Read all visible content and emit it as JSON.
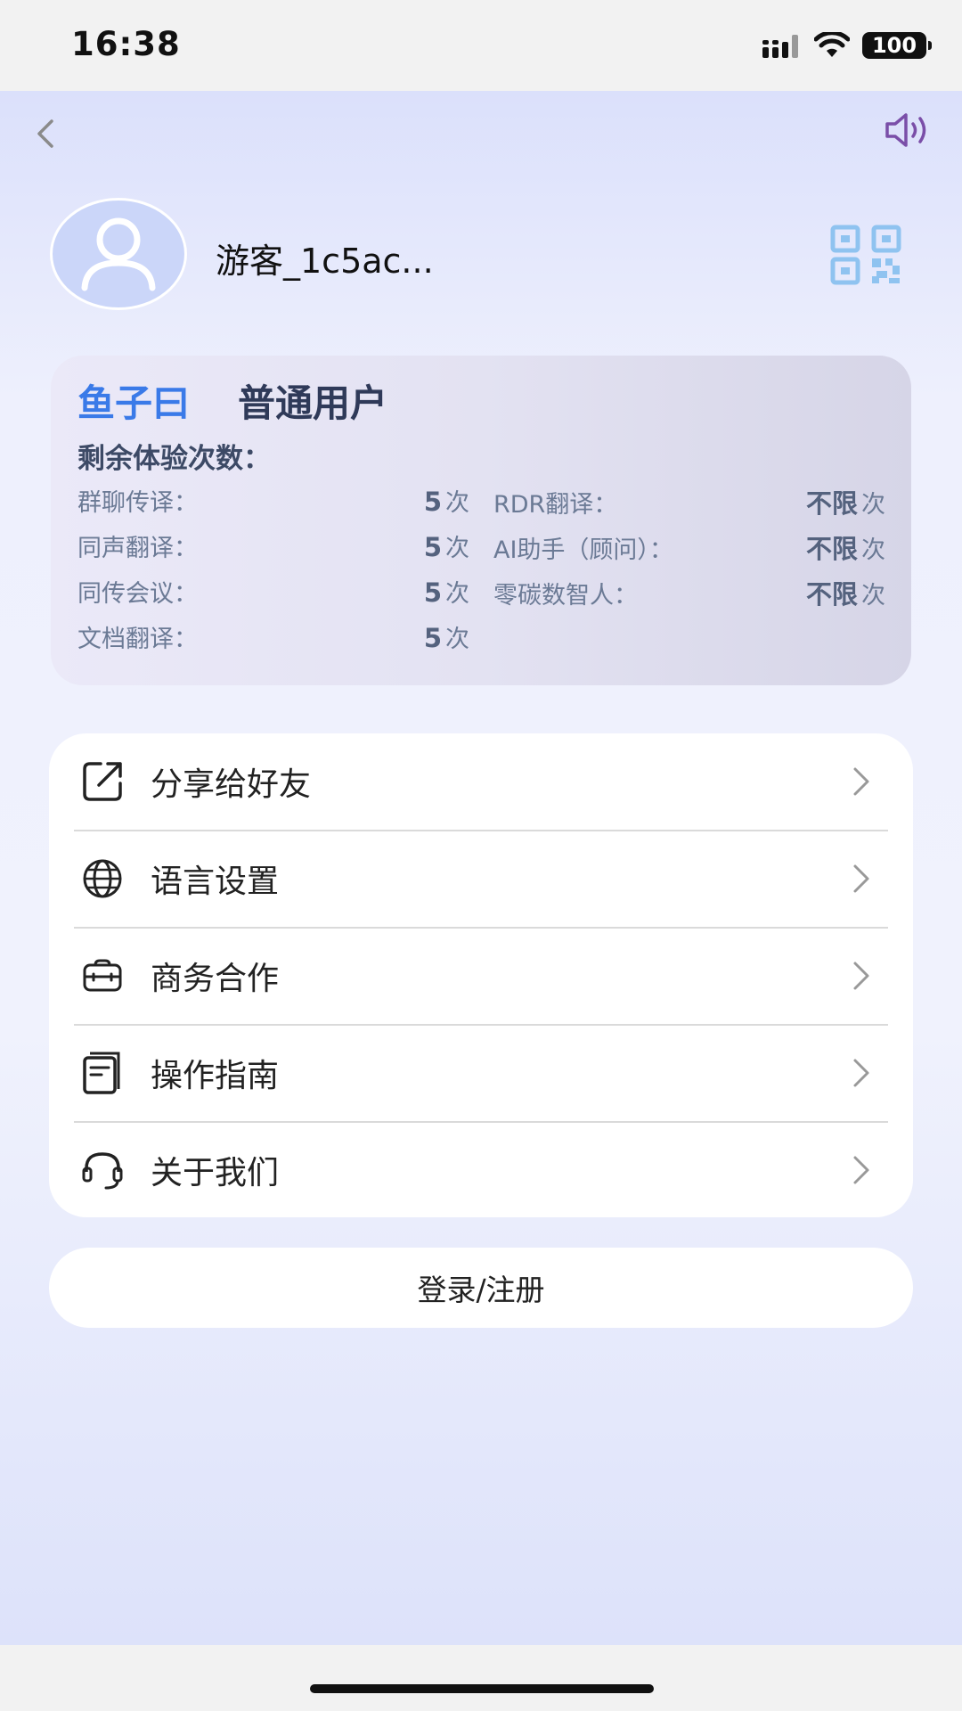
{
  "status_bar": {
    "time": "16:38",
    "battery": "100"
  },
  "profile": {
    "username": "游客_1c5ac..."
  },
  "membership": {
    "brand": "鱼子曰",
    "level": "普通用户",
    "remaining_title": "剩余体验次数：",
    "quotas_left": [
      {
        "label": "群聊传译：",
        "value": "5",
        "unit": "次"
      },
      {
        "label": "同声翻译：",
        "value": "5",
        "unit": "次"
      },
      {
        "label": "同传会议：",
        "value": "5",
        "unit": "次"
      },
      {
        "label": "文档翻译：",
        "value": "5",
        "unit": "次"
      }
    ],
    "quotas_right": [
      {
        "label": "RDR翻译：",
        "value": "不限",
        "unit": "次"
      },
      {
        "label": "AI助手（顾问）：",
        "value": "不限",
        "unit": "次"
      },
      {
        "label": "零碳数智人：",
        "value": "不限",
        "unit": "次"
      }
    ]
  },
  "menu": {
    "items": [
      {
        "label": "分享给好友",
        "icon": "share-icon"
      },
      {
        "label": "语言设置",
        "icon": "globe-icon"
      },
      {
        "label": "商务合作",
        "icon": "briefcase-icon"
      },
      {
        "label": "操作指南",
        "icon": "guide-icon"
      },
      {
        "label": "关于我们",
        "icon": "headset-icon"
      }
    ]
  },
  "login_button": {
    "label": "登录/注册"
  },
  "colors": {
    "brand_blue": "#3a7ae8",
    "qr_blue": "#8fc3f0",
    "speaker_purple": "#7a4ea8"
  }
}
